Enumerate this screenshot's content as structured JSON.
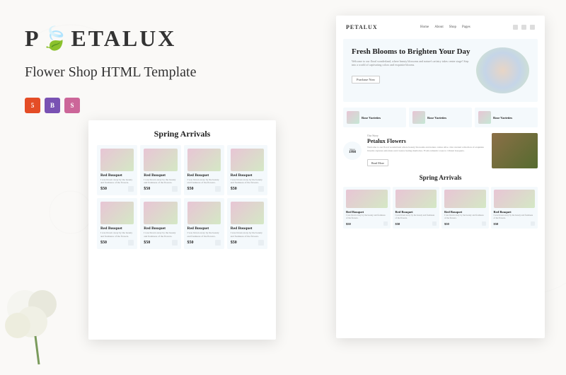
{
  "brand": {
    "name": "PETALUX",
    "p": "P",
    "rest": "ETALUX"
  },
  "subtitle": "Flower Shop HTML Template",
  "badges": {
    "html": "5",
    "bootstrap": "B",
    "sass": "S"
  },
  "nav": {
    "links": [
      "Home",
      "About",
      "Shop",
      "Pages"
    ]
  },
  "hero": {
    "title": "Fresh Blooms to Brighten Your Day",
    "desc": "Welcome to our floral wonderland, where beauty blossoms and nature's artistry takes center stage! Step into a world of captivating colors and exquisite blooms.",
    "button": "Purchase Now"
  },
  "categories": [
    {
      "label": "Rose Varieties"
    },
    {
      "label": "Rose Varieties"
    },
    {
      "label": "Rose Varieties"
    }
  ],
  "story": {
    "since_label": "Since",
    "year": "1998",
    "label": "Our Story",
    "title": "Petalux Flowers",
    "desc": "Welcome to our floral wonderland where beauty blossoms and nature comes alive. Our curated collection of exquisite blooms captures emotions and creates lasting memories. From romantic roses to vibrant bouquets.",
    "button": "Read More"
  },
  "section_left": "Spring Arrivals",
  "section_right": "Spring Arrivals",
  "product": {
    "title": "Red Bouquet",
    "desc": "I was blown away by the beauty and freshness of the flowers.",
    "price": "$50"
  }
}
